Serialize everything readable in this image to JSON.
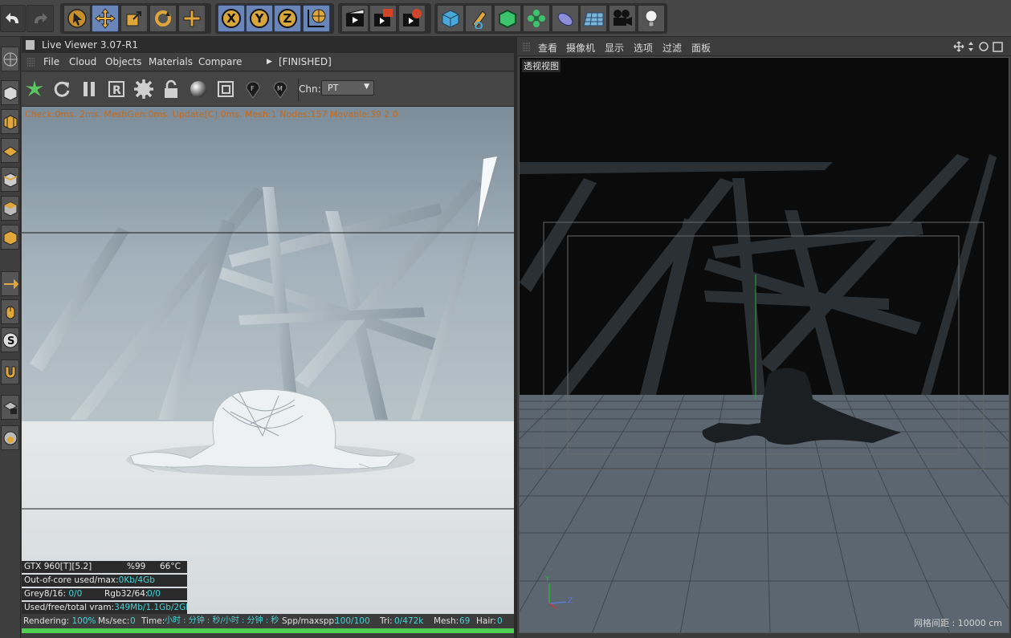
{
  "top_toolbar": {
    "axis_labels": [
      "X",
      "Y",
      "Z"
    ],
    "icons": [
      "undo-icon",
      "redo-icon",
      "select-arrow-icon",
      "move-icon",
      "scale-icon",
      "rotate-icon",
      "plus-icon",
      "world-coord-icon",
      "render-view-icon",
      "render-picture-queue-icon",
      "render-settings-icon",
      "cube-icon",
      "pen-icon",
      "subdivide-icon",
      "cloner-icon",
      "deformer-icon",
      "floor-icon",
      "camera-icon",
      "light-icon"
    ]
  },
  "left_tools": [
    "tool-sphere-icon",
    "tool-cube-icon",
    "tool-checker-icon",
    "tool-grid-icon",
    "tool-edge-icon",
    "tool-box-icon",
    "tool-box2-icon",
    "tool-arrow-icon",
    "tool-mouse-icon",
    "tool-s-icon",
    "tool-magnet-icon",
    "tool-lock-grid-icon",
    "tool-lock2-icon"
  ],
  "live_viewer": {
    "title": "Live Viewer 3.07-R1",
    "menu": [
      "File",
      "Cloud",
      "Objects",
      "Materials",
      "Compare"
    ],
    "finished": "[FINISHED]",
    "chn_label": "Chn:",
    "chn_value": "PT",
    "stats_line": "Check:0ms. 2ms. MeshGen:0ms. Update[C]:0ms. Mesh:1 Nodes:157 Movable:39 2 0",
    "gpu": {
      "name": "GTX 960[T][5.2]",
      "usage": "%99",
      "temp": "66°C"
    },
    "out_of_core_label": "Out-of-core used/max:",
    "out_of_core_value": "0Kb/4Gb",
    "grey_label": "Grey8/16:",
    "grey_value": "0/0",
    "rgb_label": "Rgb32/64:",
    "rgb_value": "0/0",
    "vram_label": "Used/free/total vram:",
    "vram_value": "349Mb/1.1Gb/2Gb",
    "status": {
      "rendering_label": "Rendering:",
      "rendering_value": "100%",
      "mssec_label": "Ms/sec:",
      "mssec_value": "0",
      "time_label": "Time:",
      "time_value": "小时 : 分钟 : 秒/小时 : 分钟 : 秒",
      "spp_label": "Spp/maxspp:",
      "spp_value": "100/100",
      "tri_label": "Tri:",
      "tri_value": "0/472k",
      "mesh_label": "Mesh:",
      "mesh_value": "69",
      "hair_label": "Hair:",
      "hair_value": "0"
    },
    "progress": 1.0
  },
  "viewport": {
    "menu": [
      "查看",
      "摄像机",
      "显示",
      "选项",
      "过滤",
      "面板"
    ],
    "label": "透视视图",
    "grid_spacing": "网格间距 : 10000 cm",
    "axis_y": "Y",
    "axis_z": "Z"
  },
  "colors": {
    "accent_blue": "#6a86b8",
    "progress_green": "#4fd054",
    "stats_orange": "#c46a1a",
    "cyan_values": "#45d4d8"
  }
}
